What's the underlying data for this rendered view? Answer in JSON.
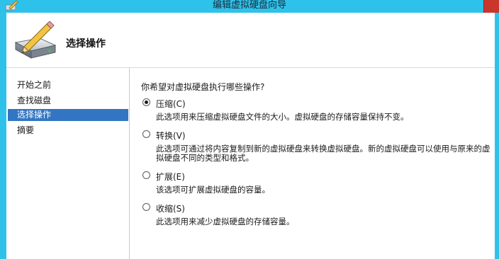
{
  "window": {
    "title": "编辑虚拟硬盘向导",
    "titlebar_color": "#2ec2ea"
  },
  "icons": {
    "app": "wizard-pencil-icon",
    "header": "hard-disk-pencil-icon"
  },
  "header": {
    "title": "选择操作"
  },
  "nav": {
    "items": [
      {
        "label": "开始之前",
        "selected": false
      },
      {
        "label": "查找磁盘",
        "selected": false
      },
      {
        "label": "选择操作",
        "selected": true
      },
      {
        "label": "摘要",
        "selected": false
      }
    ]
  },
  "content": {
    "question": "你希望对虚拟硬盘执行哪些操作?",
    "options": [
      {
        "label": "压缩(C)",
        "checked": true,
        "description": "此选项用来压缩虚拟硬盘文件的大小。虚拟硬盘的存储容量保持不变。"
      },
      {
        "label": "转换(V)",
        "checked": false,
        "description": "此选项可通过将内容复制到新的虚拟硬盘来转换虚拟硬盘。新的虚拟硬盘可以使用与原来的虚拟硬盘不同的类型和格式。"
      },
      {
        "label": "扩展(E)",
        "checked": false,
        "description": "该选项可扩展虚拟硬盘的容量。"
      },
      {
        "label": "收缩(S)",
        "checked": false,
        "description": "此选项用来减少虚拟硬盘的存储容量。"
      }
    ]
  }
}
